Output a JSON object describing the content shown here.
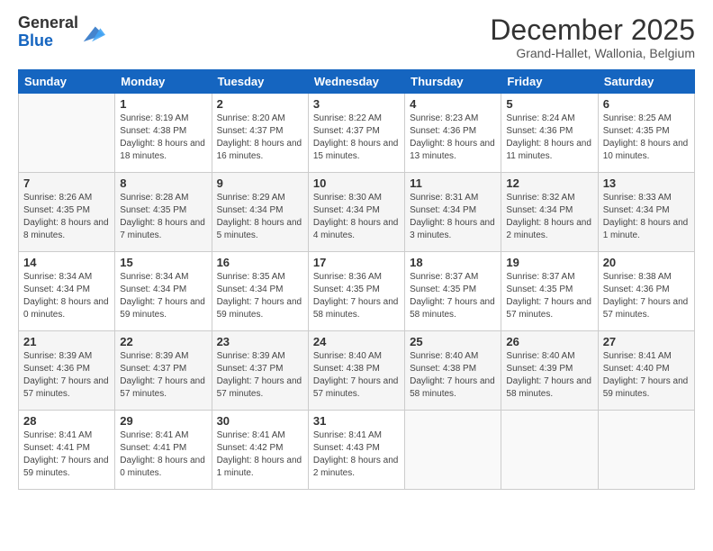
{
  "logo": {
    "general": "General",
    "blue": "Blue"
  },
  "header": {
    "month": "December 2025",
    "location": "Grand-Hallet, Wallonia, Belgium"
  },
  "weekdays": [
    "Sunday",
    "Monday",
    "Tuesday",
    "Wednesday",
    "Thursday",
    "Friday",
    "Saturday"
  ],
  "weeks": [
    [
      {
        "day": "",
        "info": ""
      },
      {
        "day": "1",
        "info": "Sunrise: 8:19 AM\nSunset: 4:38 PM\nDaylight: 8 hours and 18 minutes."
      },
      {
        "day": "2",
        "info": "Sunrise: 8:20 AM\nSunset: 4:37 PM\nDaylight: 8 hours and 16 minutes."
      },
      {
        "day": "3",
        "info": "Sunrise: 8:22 AM\nSunset: 4:37 PM\nDaylight: 8 hours and 15 minutes."
      },
      {
        "day": "4",
        "info": "Sunrise: 8:23 AM\nSunset: 4:36 PM\nDaylight: 8 hours and 13 minutes."
      },
      {
        "day": "5",
        "info": "Sunrise: 8:24 AM\nSunset: 4:36 PM\nDaylight: 8 hours and 11 minutes."
      },
      {
        "day": "6",
        "info": "Sunrise: 8:25 AM\nSunset: 4:35 PM\nDaylight: 8 hours and 10 minutes."
      }
    ],
    [
      {
        "day": "7",
        "info": "Sunrise: 8:26 AM\nSunset: 4:35 PM\nDaylight: 8 hours and 8 minutes."
      },
      {
        "day": "8",
        "info": "Sunrise: 8:28 AM\nSunset: 4:35 PM\nDaylight: 8 hours and 7 minutes."
      },
      {
        "day": "9",
        "info": "Sunrise: 8:29 AM\nSunset: 4:34 PM\nDaylight: 8 hours and 5 minutes."
      },
      {
        "day": "10",
        "info": "Sunrise: 8:30 AM\nSunset: 4:34 PM\nDaylight: 8 hours and 4 minutes."
      },
      {
        "day": "11",
        "info": "Sunrise: 8:31 AM\nSunset: 4:34 PM\nDaylight: 8 hours and 3 minutes."
      },
      {
        "day": "12",
        "info": "Sunrise: 8:32 AM\nSunset: 4:34 PM\nDaylight: 8 hours and 2 minutes."
      },
      {
        "day": "13",
        "info": "Sunrise: 8:33 AM\nSunset: 4:34 PM\nDaylight: 8 hours and 1 minute."
      }
    ],
    [
      {
        "day": "14",
        "info": "Sunrise: 8:34 AM\nSunset: 4:34 PM\nDaylight: 8 hours and 0 minutes."
      },
      {
        "day": "15",
        "info": "Sunrise: 8:34 AM\nSunset: 4:34 PM\nDaylight: 7 hours and 59 minutes."
      },
      {
        "day": "16",
        "info": "Sunrise: 8:35 AM\nSunset: 4:34 PM\nDaylight: 7 hours and 59 minutes."
      },
      {
        "day": "17",
        "info": "Sunrise: 8:36 AM\nSunset: 4:35 PM\nDaylight: 7 hours and 58 minutes."
      },
      {
        "day": "18",
        "info": "Sunrise: 8:37 AM\nSunset: 4:35 PM\nDaylight: 7 hours and 58 minutes."
      },
      {
        "day": "19",
        "info": "Sunrise: 8:37 AM\nSunset: 4:35 PM\nDaylight: 7 hours and 57 minutes."
      },
      {
        "day": "20",
        "info": "Sunrise: 8:38 AM\nSunset: 4:36 PM\nDaylight: 7 hours and 57 minutes."
      }
    ],
    [
      {
        "day": "21",
        "info": "Sunrise: 8:39 AM\nSunset: 4:36 PM\nDaylight: 7 hours and 57 minutes."
      },
      {
        "day": "22",
        "info": "Sunrise: 8:39 AM\nSunset: 4:37 PM\nDaylight: 7 hours and 57 minutes."
      },
      {
        "day": "23",
        "info": "Sunrise: 8:39 AM\nSunset: 4:37 PM\nDaylight: 7 hours and 57 minutes."
      },
      {
        "day": "24",
        "info": "Sunrise: 8:40 AM\nSunset: 4:38 PM\nDaylight: 7 hours and 57 minutes."
      },
      {
        "day": "25",
        "info": "Sunrise: 8:40 AM\nSunset: 4:38 PM\nDaylight: 7 hours and 58 minutes."
      },
      {
        "day": "26",
        "info": "Sunrise: 8:40 AM\nSunset: 4:39 PM\nDaylight: 7 hours and 58 minutes."
      },
      {
        "day": "27",
        "info": "Sunrise: 8:41 AM\nSunset: 4:40 PM\nDaylight: 7 hours and 59 minutes."
      }
    ],
    [
      {
        "day": "28",
        "info": "Sunrise: 8:41 AM\nSunset: 4:41 PM\nDaylight: 7 hours and 59 minutes."
      },
      {
        "day": "29",
        "info": "Sunrise: 8:41 AM\nSunset: 4:41 PM\nDaylight: 8 hours and 0 minutes."
      },
      {
        "day": "30",
        "info": "Sunrise: 8:41 AM\nSunset: 4:42 PM\nDaylight: 8 hours and 1 minute."
      },
      {
        "day": "31",
        "info": "Sunrise: 8:41 AM\nSunset: 4:43 PM\nDaylight: 8 hours and 2 minutes."
      },
      {
        "day": "",
        "info": ""
      },
      {
        "day": "",
        "info": ""
      },
      {
        "day": "",
        "info": ""
      }
    ]
  ]
}
